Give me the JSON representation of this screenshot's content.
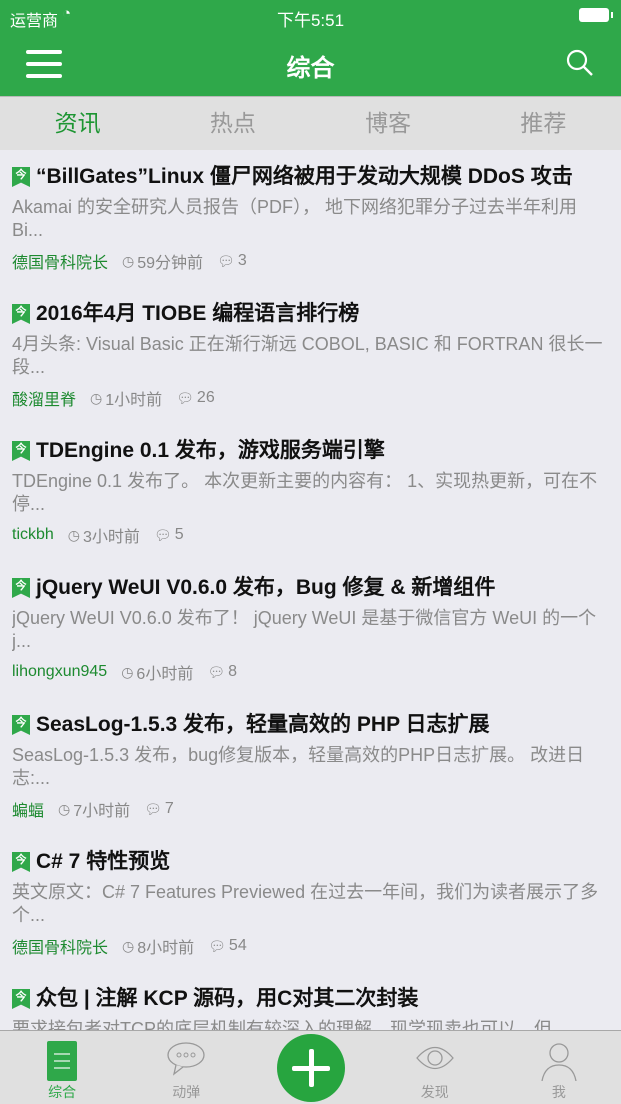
{
  "status_bar": {
    "carrier": "运营商",
    "time": "下午5:51"
  },
  "nav": {
    "title": "综合"
  },
  "tabs": [
    {
      "label": "资讯",
      "active": true
    },
    {
      "label": "热点"
    },
    {
      "label": "博客"
    },
    {
      "label": "推荐"
    }
  ],
  "news": [
    {
      "title": "“BillGates”Linux 僵尸网络被用于发动大规模 DDoS 攻击",
      "summary": "Akamai 的安全研究人员报告（PDF）， 地下网络犯罪分子过去半年利用 Bi...",
      "author": "德国骨科院长",
      "time": "59分钟前",
      "comments": "3"
    },
    {
      "title": "2016年4月 TIOBE 编程语言排行榜",
      "summary": "4月头条: Visual Basic 正在渐行渐远 COBOL, BASIC 和 FORTRAN 很长一段...",
      "author": "酸溜里脊",
      "time": "1小时前",
      "comments": "26"
    },
    {
      "title": "TDEngine 0.1 发布，游戏服务端引擎",
      "summary": "TDEngine 0.1 发布了。 本次更新主要的内容有： 1、实现热更新，可在不停...",
      "author": "tickbh",
      "time": "3小时前",
      "comments": "5"
    },
    {
      "title": "jQuery WeUI V0.6.0 发布，Bug 修复 & 新增组件",
      "summary": "jQuery WeUI V0.6.0 发布了！ jQuery WeUI 是基于微信官方 WeUI 的一个j...",
      "author": "lihongxun945",
      "time": "6小时前",
      "comments": "8"
    },
    {
      "title": "SeasLog-1.5.3 发布，轻量高效的 PHP 日志扩展",
      "summary": "SeasLog-1.5.3 发布，bug修复版本，轻量高效的PHP日志扩展。 改进日志:...",
      "author": "蝙蝠",
      "time": "7小时前",
      "comments": "7"
    },
    {
      "title": "C# 7 特性预览",
      "summary": "英文原文：C# 7 Features Previewed 在过去一年间，我们为读者展示了多个...",
      "author": "德国骨科院长",
      "time": "8小时前",
      "comments": "54"
    },
    {
      "title": "众包 | 注解 KCP 源码，用C对其二次封装",
      "summary": "要求接包者对TCP的底层机制有较深入的理解，现学现卖也可以，但...",
      "author": "",
      "time": "",
      "comments": ""
    }
  ],
  "bottom_tabs": [
    {
      "label": "综合",
      "icon": "document-icon",
      "active": true
    },
    {
      "label": "动弹",
      "icon": "chat-bubble-icon"
    },
    {
      "label": "",
      "icon": "plus-icon"
    },
    {
      "label": "发现",
      "icon": "eye-icon"
    },
    {
      "label": "我",
      "icon": "person-icon"
    }
  ],
  "colors": {
    "brand": "#2fa84a",
    "author": "#1d8a30"
  }
}
